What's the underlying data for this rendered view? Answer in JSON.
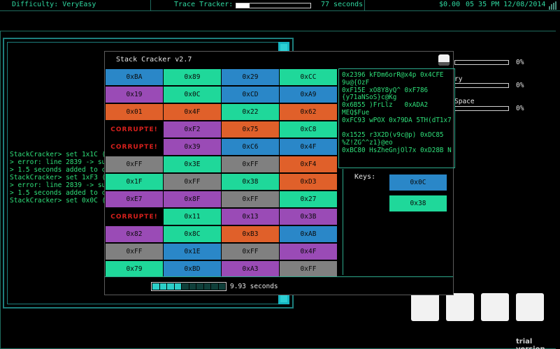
{
  "topbar": {
    "difficulty": "Difficulty: VeryEasy",
    "trace_label": "Trace Tracker:",
    "trace_level": 0.18,
    "trace_time": "77 seconds",
    "money": "$0.00",
    "clock": "05 35 PM 12/08/2014"
  },
  "terminal": {
    "lines": [
      "StackCracker> set 1x1C (",
      "> error: line 2839 -> su",
      "> 1.5 seconds added to c",
      "StackCracker> set 1xF3 (",
      "> error: line 2839 -> su",
      "> 1.5 seconds added to c",
      "StackCracker> set 0x0C ("
    ]
  },
  "right_items": [
    {
      "label": "",
      "pct": "0%",
      "level": 0
    },
    {
      "label": "ry",
      "pct": "0%",
      "level": 0
    },
    {
      "label": "Space",
      "pct": "0%",
      "level": 0
    }
  ],
  "stack_cracker": {
    "title": "Stack Cracker v2.7",
    "corrupt_label": "CORRUPTE!",
    "grid": [
      [
        {
          "v": "0xBA",
          "c": "blue"
        },
        {
          "v": "0x89",
          "c": "green"
        },
        {
          "v": "0x29",
          "c": "blue"
        },
        {
          "v": "0xCC",
          "c": "green"
        }
      ],
      [
        {
          "v": "0x19",
          "c": "purple"
        },
        {
          "v": "0x0C",
          "c": "green"
        },
        {
          "v": "0xCD",
          "c": "blue"
        },
        {
          "v": "0xA9",
          "c": "blue"
        }
      ],
      [
        {
          "v": "0x01",
          "c": "orange"
        },
        {
          "v": "0x4F",
          "c": "orange"
        },
        {
          "v": "0x22",
          "c": "green"
        },
        {
          "v": "0x62",
          "c": "orange"
        }
      ],
      [
        {
          "v": "CORRUPTE!",
          "c": "corrupt"
        },
        {
          "v": "0xF2",
          "c": "purple"
        },
        {
          "v": "0x75",
          "c": "orange"
        },
        {
          "v": "0xC8",
          "c": "green"
        }
      ],
      [
        {
          "v": "CORRUPTE!",
          "c": "corrupt"
        },
        {
          "v": "0x39",
          "c": "purple"
        },
        {
          "v": "0xC6",
          "c": "blue"
        },
        {
          "v": "0x4F",
          "c": "blue"
        }
      ],
      [
        {
          "v": "0xFF",
          "c": "gray"
        },
        {
          "v": "0x3E",
          "c": "green"
        },
        {
          "v": "0xFF",
          "c": "gray"
        },
        {
          "v": "0xF4",
          "c": "orange"
        }
      ],
      [
        {
          "v": "0x1F",
          "c": "green"
        },
        {
          "v": "0xFF",
          "c": "gray"
        },
        {
          "v": "0x38",
          "c": "green"
        },
        {
          "v": "0xD3",
          "c": "orange"
        }
      ],
      [
        {
          "v": "0xE7",
          "c": "purple"
        },
        {
          "v": "0x8F",
          "c": "purple"
        },
        {
          "v": "0xFF",
          "c": "gray"
        },
        {
          "v": "0x27",
          "c": "green"
        }
      ],
      [
        {
          "v": "CORRUPTE!",
          "c": "corrupt"
        },
        {
          "v": "0x11",
          "c": "green"
        },
        {
          "v": "0x13",
          "c": "purple"
        },
        {
          "v": "0x3B",
          "c": "purple"
        }
      ],
      [
        {
          "v": "0x82",
          "c": "purple"
        },
        {
          "v": "0x8C",
          "c": "green"
        },
        {
          "v": "0xB3",
          "c": "orange"
        },
        {
          "v": "0xAB",
          "c": "blue"
        }
      ],
      [
        {
          "v": "0xFF",
          "c": "gray"
        },
        {
          "v": "0x1E",
          "c": "blue"
        },
        {
          "v": "0xFF",
          "c": "gray"
        },
        {
          "v": "0x4F",
          "c": "purple"
        }
      ],
      [
        {
          "v": "0x79",
          "c": "green"
        },
        {
          "v": "0xBD",
          "c": "blue"
        },
        {
          "v": "0xA3",
          "c": "purple"
        },
        {
          "v": "0xFF",
          "c": "gray"
        }
      ]
    ],
    "memdump": [
      "0x2396 kFDm6orR@x4p 0x4CFE",
      "9u@{OzF",
      "0xF15E xO8Y8yQ^ 0xF786",
      "{y71aNSoS}c@Kg",
      "0x6B55 )FrLlz   0xADA2",
      "MEQ$Fue",
      "0xFC93 wPOX 0x79DA 5TH(dT1x7",
      "",
      "0x1525 r3X2D(v9c@p) 0xDC85",
      "%Z!ZG^^z1}@eo",
      "0xBC80 HsZheGnjOl7x 0xD28B N"
    ],
    "keys_label": "Keys:",
    "keys": [
      {
        "v": "0x0C",
        "c": "blue"
      },
      {
        "v": "0x38",
        "c": "green"
      }
    ],
    "timer_level": 0.4,
    "timer_text": "9.93 seconds"
  },
  "trial": "trial version",
  "colors": {
    "blue": "#2a87c8",
    "green": "#1fd89a",
    "purple": "#9a4bb6",
    "orange": "#e0602a",
    "gray": "#808080",
    "accent": "#2ccfc9"
  }
}
